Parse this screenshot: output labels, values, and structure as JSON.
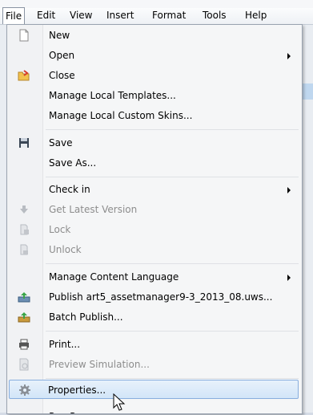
{
  "menubar": {
    "items": [
      {
        "label": "File",
        "active": true
      },
      {
        "label": "Edit"
      },
      {
        "label": "View"
      },
      {
        "label": "Insert"
      },
      {
        "label": "Format"
      },
      {
        "label": "Tools"
      },
      {
        "label": "Help"
      }
    ]
  },
  "file_menu": {
    "new": "New",
    "open": "Open",
    "close": "Close",
    "manage_local_templates": "Manage Local Templates...",
    "manage_local_custom_skins": "Manage Local Custom Skins...",
    "save": "Save",
    "save_as": "Save As...",
    "check_in": "Check in",
    "get_latest_version": "Get Latest Version",
    "lock": "Lock",
    "unlock": "Unlock",
    "manage_content_language": "Manage Content Language",
    "publish": "Publish art5_assetmanager9-3_2013_08.uws...",
    "batch_publish": "Batch Publish...",
    "print": "Print...",
    "preview_simulation": "Preview Simulation...",
    "properties": "Properties...",
    "partial_next": "Pr... P..."
  },
  "colors": {
    "hover_bg": "#d2e5f8",
    "hover_border": "#88aede",
    "disabled_text": "#8d8d8d"
  }
}
